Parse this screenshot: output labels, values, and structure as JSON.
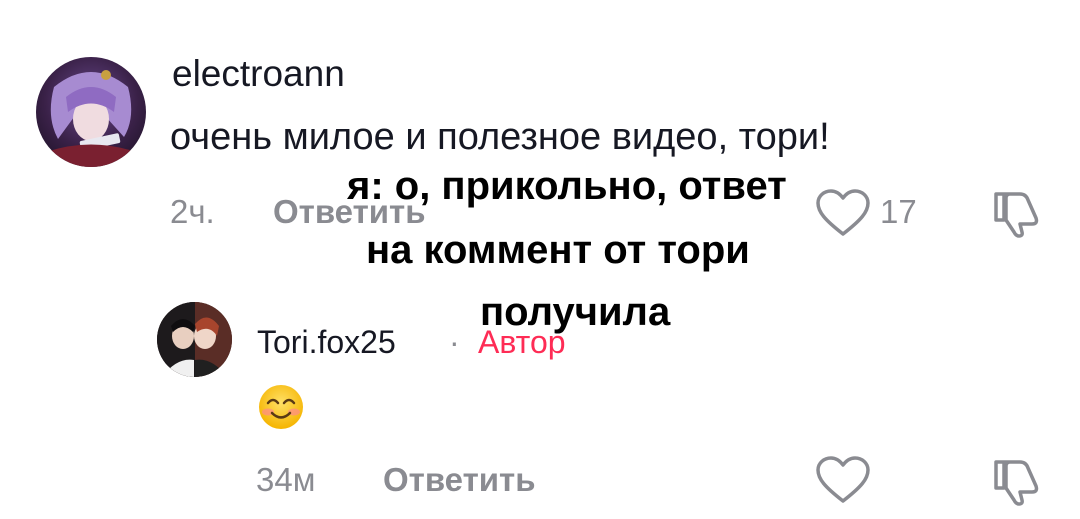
{
  "comment": {
    "username": "electroann",
    "text": "очень милое и полезное видео, тори!",
    "time": "2ч.",
    "reply_label": "Ответить",
    "likes": "17",
    "avatar_icon": "anime-avatar-purple-hair"
  },
  "reply": {
    "username": "Tori.fox25",
    "separator": "·",
    "author_badge": "Автор",
    "text_emoji": "smiling-face-emoji",
    "time": "34м",
    "reply_label": "Ответить",
    "avatar_icon": "photo-avatar"
  },
  "overlay_caption": {
    "line1": "я: о, прикольно, ответ",
    "line2": "на коммент от тори",
    "line3": "получила"
  },
  "colors": {
    "text": "#161823",
    "muted": "#8a8b91",
    "author_accent": "#fe2c55"
  },
  "icons": {
    "like": "heart-outline-icon",
    "dislike": "thumbs-down-outline-icon"
  }
}
